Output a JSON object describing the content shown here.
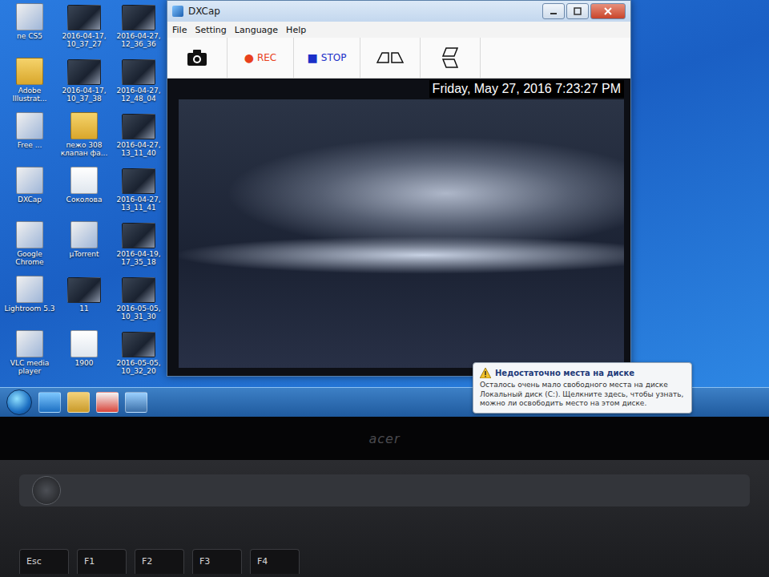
{
  "desktop": {
    "icons": [
      {
        "label": "ne CS5",
        "kind": "app"
      },
      {
        "label": "2016-04-17, 10_37_27",
        "kind": "image"
      },
      {
        "label": "2016-04-27, 12_36_36",
        "kind": "image"
      },
      {
        "label": "Adobe Illustrat...",
        "kind": "folder"
      },
      {
        "label": "2016-04-17, 10_37_38",
        "kind": "image"
      },
      {
        "label": "2016-04-27, 12_48_04",
        "kind": "image"
      },
      {
        "label": "Free ...",
        "kind": "app"
      },
      {
        "label": "пежо 308 клапан фа...",
        "kind": "folder"
      },
      {
        "label": "2016-04-27, 13_11_40",
        "kind": "image"
      },
      {
        "label": "DXCap",
        "kind": "app"
      },
      {
        "label": "Соколова",
        "kind": "file"
      },
      {
        "label": "2016-04-27, 13_11_41",
        "kind": "image"
      },
      {
        "label": "Google Chrome",
        "kind": "app"
      },
      {
        "label": "µTorrent",
        "kind": "app"
      },
      {
        "label": "2016-04-19, 17_35_18",
        "kind": "image"
      },
      {
        "label": "Lightroom 5.3",
        "kind": "app"
      },
      {
        "label": "11",
        "kind": "image"
      },
      {
        "label": "2016-05-05, 10_31_30",
        "kind": "image"
      },
      {
        "label": "VLC media player",
        "kind": "app"
      },
      {
        "label": "1900",
        "kind": "file"
      },
      {
        "label": "2016-05-05, 10_32_20",
        "kind": "image"
      }
    ]
  },
  "window": {
    "title": "DXCap",
    "menu": [
      "File",
      "Setting",
      "Language",
      "Help"
    ],
    "toolbar": [
      {
        "kind": "snapshot",
        "icon": "",
        "label": "",
        "color": "#111111"
      },
      {
        "kind": "record",
        "icon": "●",
        "label": "REC",
        "color": "#e8401c"
      },
      {
        "kind": "stop",
        "icon": "■",
        "label": "STOP",
        "color": "#1a2fc8"
      },
      {
        "kind": "flip-h",
        "icon": "",
        "label": "",
        "color": "#111111"
      },
      {
        "kind": "flip-v",
        "icon": "",
        "label": "",
        "color": "#111111"
      }
    ],
    "timestamp": "Friday, May 27, 2016 7:23:27 PM"
  },
  "balloon": {
    "title": "Недостаточно места на диске",
    "text": "Осталось очень мало свободного места на диске Локальный диск (C:). Щелкните здесь, чтобы узнать, можно ли освободить место на этом диске."
  },
  "laptop": {
    "brand": "acer"
  },
  "keyboard": {
    "keys": [
      "Esc",
      "F1",
      "F2",
      "F3",
      "F4"
    ]
  }
}
